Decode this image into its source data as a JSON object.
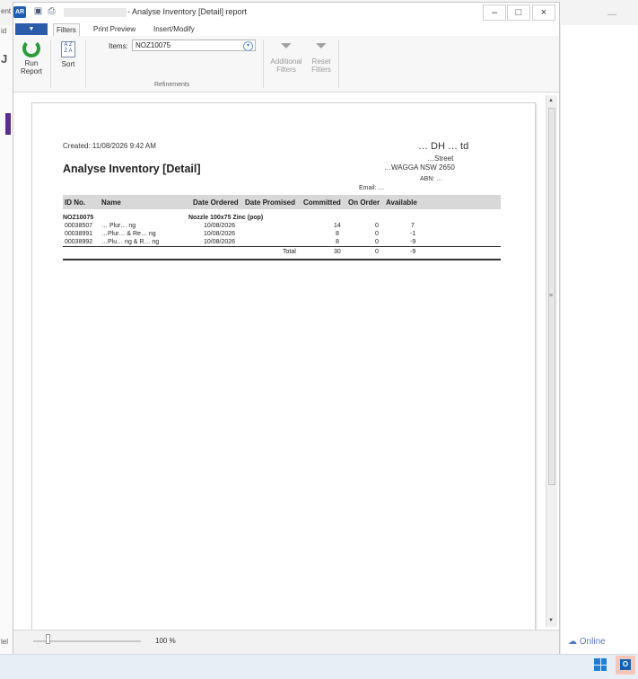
{
  "window": {
    "app_icon": "AR",
    "title": "- Analyse Inventory [Detail] report",
    "controls": {
      "minimize": "–",
      "maximize": "□",
      "close": "×"
    }
  },
  "ribbon": {
    "file_tab": "▼",
    "tabs": [
      {
        "label": "Filters"
      },
      {
        "label": "Print Preview"
      },
      {
        "label": "Insert/Modify"
      }
    ],
    "run_report": "Run Report",
    "sort": "Sort",
    "items_label": "Items:",
    "items_value": "NOZ10075",
    "refinements_label": "Refinements",
    "additional_filters": "Additional Filters",
    "reset_filters": "Reset Filters"
  },
  "report": {
    "created": "Created: 11/08/2026 9:42 AM",
    "title": "Analyse Inventory [Detail]",
    "company_name": "… DH … td",
    "street": "…Street",
    "city": "…WAGGA NSW 2650",
    "abn": "ABN: …",
    "email": "Email: …",
    "columns": [
      "ID No.",
      "Name",
      "Date Ordered",
      "Date Promised",
      "Committed",
      "On Order",
      "Available"
    ],
    "group": {
      "id": "NOZ10075",
      "description": "Nozzle 100x75 Zinc (pop)"
    },
    "rows": [
      {
        "id": "00038507",
        "name": "… Plur… ng",
        "date_ordered": "10/08/2026",
        "committed": "14",
        "on_order": "0",
        "available": "7"
      },
      {
        "id": "00038991",
        "name": "…Plur… & Re… ng",
        "date_ordered": "10/08/2026",
        "committed": "8",
        "on_order": "0",
        "available": "-1"
      },
      {
        "id": "00038992",
        "name": "…Plu… ng & R… ng",
        "date_ordered": "10/08/2026",
        "committed": "8",
        "on_order": "0",
        "available": "-9"
      }
    ],
    "total": {
      "label": "Total",
      "committed": "30",
      "on_order": "0",
      "available": "-9"
    }
  },
  "status_bar": {
    "zoom": "100 %"
  },
  "background": {
    "online": "Online",
    "left_labels": [
      "ent",
      "id",
      "J",
      "lel"
    ]
  },
  "taskbar": {
    "outlook_icon": "O"
  }
}
